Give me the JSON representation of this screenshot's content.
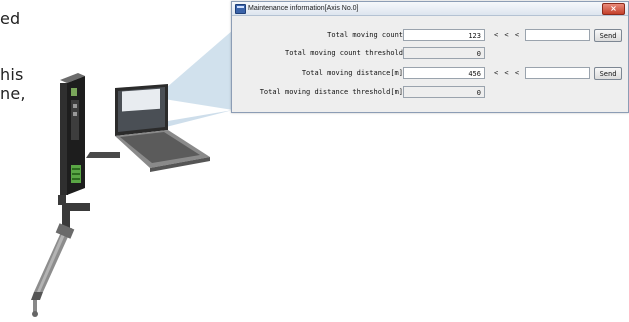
{
  "intro_text_fragments": [
    "ed",
    "his",
    "ne,"
  ],
  "window": {
    "title": "Maintenance information[Axis No.0]",
    "close_glyph": "×",
    "rows": [
      {
        "label": "Total moving count",
        "value": "123",
        "arrows": "< < <",
        "send_label": "Send"
      },
      {
        "label": "Total moving count threshold",
        "value": "0"
      },
      {
        "label": "Total moving distance[m]",
        "value": "456",
        "arrows": "< < <",
        "send_label": "Send"
      },
      {
        "label": "Total moving distance threshold[m]",
        "value": "0"
      }
    ]
  },
  "colors": {
    "callout_fill": "#c9dcea",
    "titlebar": "#dde5ef",
    "close_button": "#c4402b"
  },
  "icons": [
    "app-window-icon",
    "close-icon",
    "controller-unit-illustration",
    "laptop-illustration",
    "actuator-illustration"
  ]
}
